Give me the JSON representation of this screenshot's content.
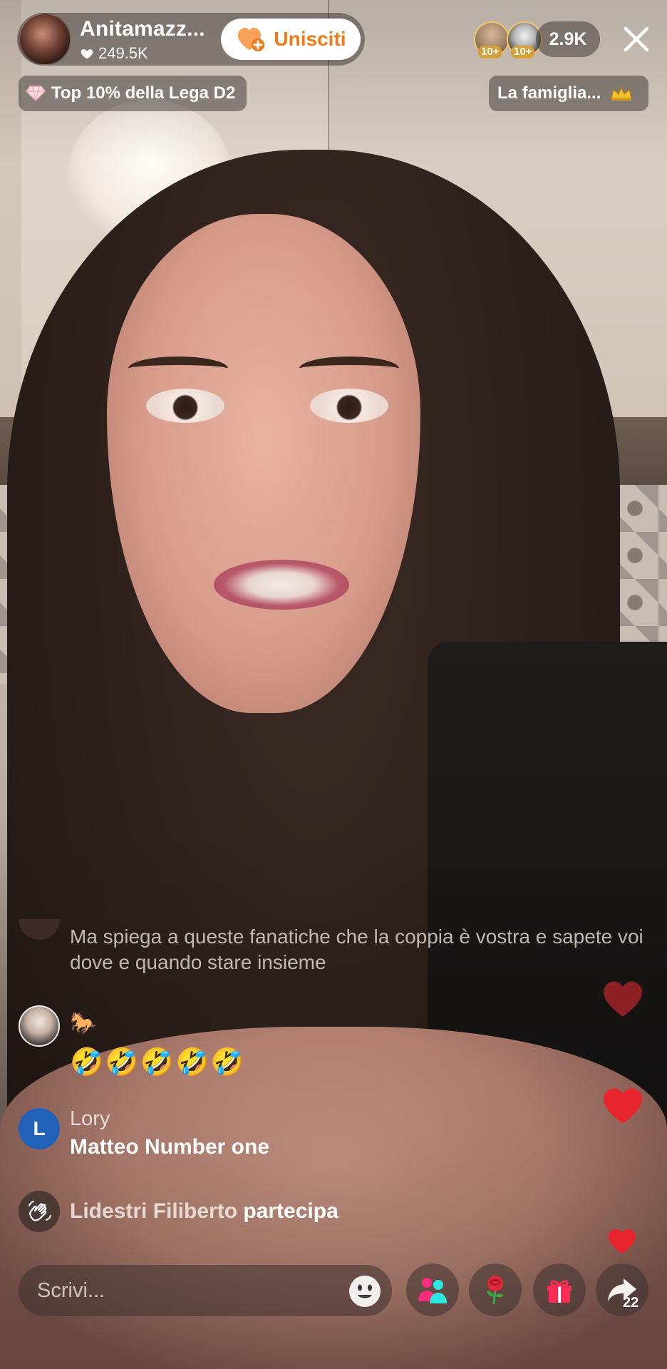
{
  "host": {
    "name": "Anitamazz...",
    "likes": "249.5K",
    "join_label": "Unisciti"
  },
  "viewers": {
    "badge_1": "10+",
    "badge_2": "10+",
    "count": "2.9K"
  },
  "league": {
    "label": "Top 10% della Lega D2"
  },
  "family": {
    "label": "La famiglia..."
  },
  "comments": {
    "c1": {
      "text": "Ma spiega a queste fanatiche che la coppia è vostra e sapete voi dove e quando stare insieme"
    },
    "c2": {
      "badge": "🐎",
      "text": "🤣🤣🤣🤣🤣"
    },
    "c3": {
      "avatar_letter": "L",
      "user": "Lory",
      "text": "Matteo Number one"
    },
    "c4": {
      "user": "Lidestri Filiberto",
      "action": "partecipa"
    }
  },
  "bottom_bar": {
    "input_placeholder": "Scrivi...",
    "share_count": "22"
  },
  "colors": {
    "join_accent": "#f07a1a",
    "heart_red": "#e8242f",
    "avatar_blue": "#1f62b8"
  },
  "icons": [
    "heart-icon",
    "join-heart-icon",
    "close-icon",
    "diamond-icon",
    "crown-icon",
    "waving-hand-icon",
    "emoji-icon",
    "multi-guest-icon",
    "rose-icon",
    "gift-icon",
    "share-icon"
  ]
}
